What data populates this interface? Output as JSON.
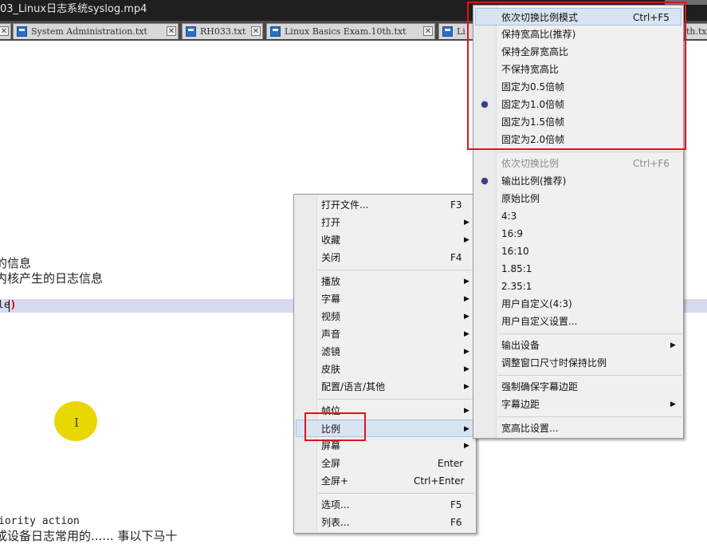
{
  "window": {
    "title": "03_Linux日志系统syslog.mp4"
  },
  "tabs": [
    {
      "label": "System Administration.txt"
    },
    {
      "label": "RH033.txt"
    },
    {
      "label": "Linux Basics Exam.10th.txt"
    },
    {
      "label": "Li"
    },
    {
      "label": "th.txt"
    }
  ],
  "editor": {
    "line1": "的信息",
    "line2": "内核产生的日志信息",
    "line3_text": "le",
    "line3_paren": ")",
    "line4": "iority   action",
    "line5": "或设备日志常用的...... 事以下马十"
  },
  "main_menu": {
    "items": [
      {
        "label": "打开文件...",
        "shortcut": "F3"
      },
      {
        "label": "打开",
        "arrow": "▶"
      },
      {
        "label": "收藏",
        "arrow": "▶"
      },
      {
        "label": "关闭",
        "shortcut": "F4"
      },
      {
        "label": "播放",
        "arrow": "▶"
      },
      {
        "label": "字幕",
        "arrow": "▶"
      },
      {
        "label": "视频",
        "arrow": "▶"
      },
      {
        "label": "声音",
        "arrow": "▶"
      },
      {
        "label": "滤镜",
        "arrow": "▶"
      },
      {
        "label": "皮肤",
        "arrow": "▶"
      },
      {
        "label": "配置/语言/其他",
        "arrow": "▶"
      },
      {
        "label": "帧位",
        "arrow": "▶"
      },
      {
        "label": "比例",
        "arrow": "▶"
      },
      {
        "label": "屏幕",
        "arrow": "▶"
      },
      {
        "label": "全屏",
        "shortcut": "Enter"
      },
      {
        "label": "全屏+",
        "shortcut": "Ctrl+Enter"
      },
      {
        "label": "选项...",
        "shortcut": "F5"
      },
      {
        "label": "列表...",
        "shortcut": "F6"
      }
    ]
  },
  "ratio_menu": {
    "items": [
      {
        "label": "依次切换比例模式",
        "shortcut": "Ctrl+F5"
      },
      {
        "label": "保持宽高比(推荐)"
      },
      {
        "label": "保持全屏宽高比"
      },
      {
        "label": "不保持宽高比"
      },
      {
        "label": "固定为0.5倍帧"
      },
      {
        "label": "固定为1.0倍帧"
      },
      {
        "label": "固定为1.5倍帧"
      },
      {
        "label": "固定为2.0倍帧"
      },
      {
        "label": "依次切换比例",
        "shortcut": "Ctrl+F6"
      },
      {
        "label": "输出比例(推荐)"
      },
      {
        "label": "原始比例"
      },
      {
        "label": "4:3"
      },
      {
        "label": "16:9"
      },
      {
        "label": "16:10"
      },
      {
        "label": "1.85:1"
      },
      {
        "label": "2.35:1"
      },
      {
        "label": "用户自定义(4:3)"
      },
      {
        "label": "用户自定义设置..."
      },
      {
        "label": "输出设备",
        "arrow": "▶"
      },
      {
        "label": "调整窗口尺寸时保持比例"
      },
      {
        "label": "强制确保字幕边距"
      },
      {
        "label": "字幕边距",
        "arrow": "▶"
      },
      {
        "label": "宽高比设置..."
      }
    ]
  },
  "colors": {
    "highlight_box": "#e0141b",
    "menu_selected": "#d9e4f2",
    "cursor_spot": "#e8d800"
  }
}
